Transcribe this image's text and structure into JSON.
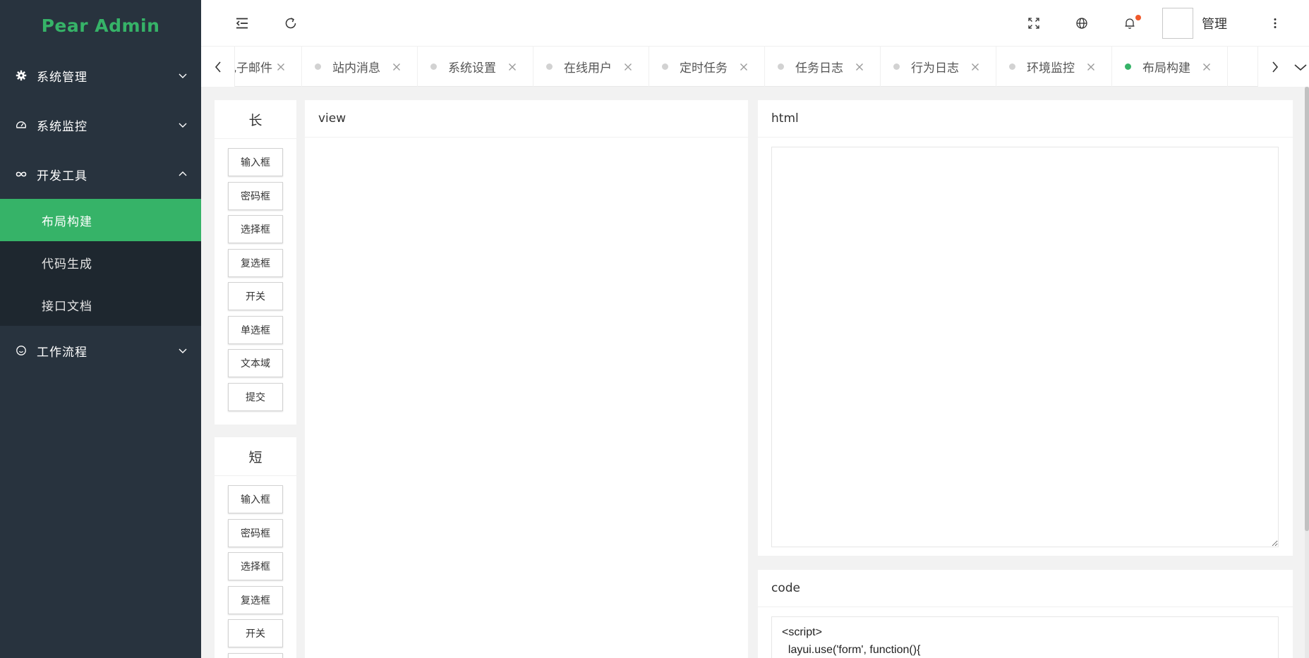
{
  "app": {
    "logo": "Pear Admin"
  },
  "colors": {
    "accent": "#36b368",
    "sidebar_bg": "#28333e",
    "submenu_bg": "#1e272f",
    "notify_dot": "#f0592b"
  },
  "sidebar": {
    "groups": [
      {
        "label": "系统管理",
        "icon": "gear-icon",
        "expanded": false
      },
      {
        "label": "系统监控",
        "icon": "dashboard-icon",
        "expanded": false
      },
      {
        "label": "开发工具",
        "icon": "infinity-icon",
        "expanded": true,
        "children": [
          {
            "label": "布局构建",
            "active": true
          },
          {
            "label": "代码生成",
            "active": false
          },
          {
            "label": "接口文档",
            "active": false
          }
        ]
      },
      {
        "label": "工作流程",
        "icon": "smile-icon",
        "expanded": false
      }
    ]
  },
  "header": {
    "user_name": "管理"
  },
  "tabs": [
    {
      "label": "电子邮件",
      "active": false
    },
    {
      "label": "站内消息",
      "active": false
    },
    {
      "label": "系统设置",
      "active": false
    },
    {
      "label": "在线用户",
      "active": false
    },
    {
      "label": "定时任务",
      "active": false
    },
    {
      "label": "任务日志",
      "active": false
    },
    {
      "label": "行为日志",
      "active": false
    },
    {
      "label": "环境监控",
      "active": false
    },
    {
      "label": "布局构建",
      "active": true
    }
  ],
  "builder": {
    "long": {
      "title": "长",
      "buttons": [
        "输入框",
        "密码框",
        "选择框",
        "复选框",
        "开关",
        "单选框",
        "文本域",
        "提交"
      ]
    },
    "short": {
      "title": "短",
      "buttons": [
        "输入框",
        "密码框",
        "选择框",
        "复选框",
        "开关"
      ]
    },
    "view_title": "view",
    "html_title": "html",
    "html_value": "",
    "code_title": "code",
    "code": "<script>\n  layui.use('form', function(){"
  }
}
